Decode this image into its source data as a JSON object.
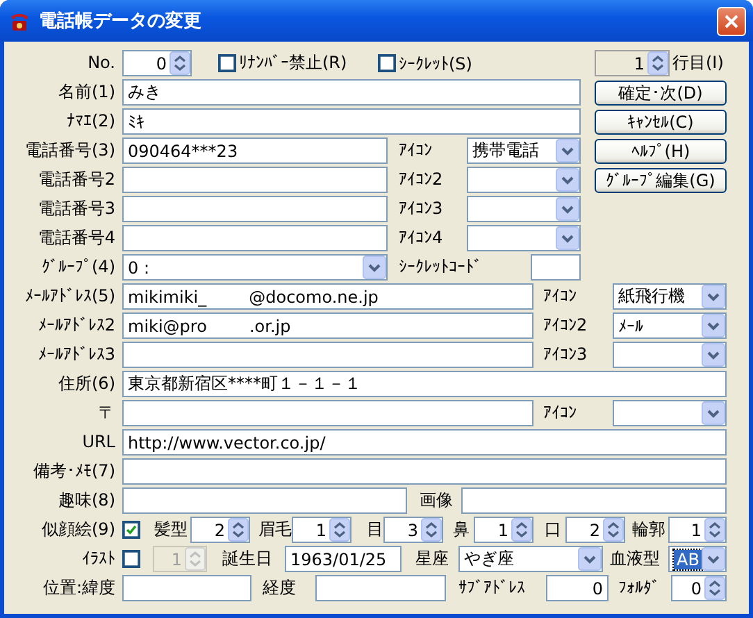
{
  "window": {
    "title": "電話帳データの変更"
  },
  "rows": [
    {
      "items": [
        {
          "kind": "label",
          "text": "No."
        },
        {
          "kind": "spin",
          "value": "0"
        },
        {
          "kind": "check",
          "label": "ﾘﾅﾝﾊﾞｰ禁止(R)",
          "checked": false
        },
        {
          "kind": "check",
          "label": "ｼｰｸﾚｯﾄ(S)",
          "checked": false
        },
        {
          "kind": "spin",
          "value": "1",
          "readonly": true
        },
        {
          "kind": "label",
          "text": "行目(I)"
        }
      ]
    },
    {
      "items": [
        {
          "kind": "label",
          "text": "名前(1)"
        },
        {
          "kind": "text",
          "value": "みき"
        },
        {
          "kind": "button",
          "text": "確定･次(D)"
        }
      ]
    },
    {
      "items": [
        {
          "kind": "label",
          "text": "ﾅﾏｴ(2)"
        },
        {
          "kind": "text",
          "value": "ﾐｷ"
        },
        {
          "kind": "button",
          "text": "ｷｬﾝｾﾙ(C)"
        }
      ]
    },
    {
      "items": [
        {
          "kind": "label",
          "text": "電話番号(3)"
        },
        {
          "kind": "text",
          "value": "090464***23"
        },
        {
          "kind": "label",
          "text": "ｱｲｺﾝ"
        },
        {
          "kind": "combo",
          "value": "携帯電話"
        },
        {
          "kind": "button",
          "text": "ﾍﾙﾌﾟ(H)"
        }
      ]
    },
    {
      "items": [
        {
          "kind": "label",
          "text": "電話番号2"
        },
        {
          "kind": "text",
          "value": ""
        },
        {
          "kind": "label",
          "text": "ｱｲｺﾝ2"
        },
        {
          "kind": "combo",
          "value": ""
        },
        {
          "kind": "button",
          "text": "ｸﾞﾙｰﾌﾟ編集(G)"
        }
      ]
    },
    {
      "items": [
        {
          "kind": "label",
          "text": "電話番号3"
        },
        {
          "kind": "text",
          "value": ""
        },
        {
          "kind": "label",
          "text": "ｱｲｺﾝ3"
        },
        {
          "kind": "combo",
          "value": ""
        }
      ]
    },
    {
      "items": [
        {
          "kind": "label",
          "text": "電話番号4"
        },
        {
          "kind": "text",
          "value": ""
        },
        {
          "kind": "label",
          "text": "ｱｲｺﾝ4"
        },
        {
          "kind": "combo",
          "value": ""
        }
      ]
    },
    {
      "items": [
        {
          "kind": "label",
          "text": "ｸﾞﾙｰﾌﾟ(4)"
        },
        {
          "kind": "combo",
          "value": "0 :"
        },
        {
          "kind": "label",
          "text": "ｼｰｸﾚｯﾄｺｰﾄﾞ"
        },
        {
          "kind": "text",
          "value": ""
        }
      ]
    },
    {
      "items": [
        {
          "kind": "label",
          "text": "ﾒｰﾙｱﾄﾞﾚｽ(5)"
        },
        {
          "kind": "text",
          "value": "mikimiki_        @docomo.ne.jp"
        },
        {
          "kind": "label",
          "text": "ｱｲｺﾝ"
        },
        {
          "kind": "combo",
          "value": "紙飛行機"
        }
      ]
    },
    {
      "items": [
        {
          "kind": "label",
          "text": "ﾒｰﾙｱﾄﾞﾚｽ2"
        },
        {
          "kind": "text",
          "value": "miki@pro        .or.jp"
        },
        {
          "kind": "label",
          "text": "ｱｲｺﾝ2"
        },
        {
          "kind": "combo",
          "value": "ﾒｰﾙ"
        }
      ]
    },
    {
      "items": [
        {
          "kind": "label",
          "text": "ﾒｰﾙｱﾄﾞﾚｽ3"
        },
        {
          "kind": "text",
          "value": ""
        },
        {
          "kind": "label",
          "text": "ｱｲｺﾝ3"
        },
        {
          "kind": "combo",
          "value": ""
        }
      ]
    },
    {
      "items": [
        {
          "kind": "label",
          "text": "住所(6)"
        },
        {
          "kind": "text",
          "value": "東京都新宿区****町１－１－１"
        }
      ]
    },
    {
      "items": [
        {
          "kind": "label",
          "text": "〒"
        },
        {
          "kind": "text",
          "value": ""
        },
        {
          "kind": "label",
          "text": "ｱｲｺﾝ"
        },
        {
          "kind": "combo",
          "value": ""
        }
      ]
    },
    {
      "items": [
        {
          "kind": "label",
          "text": "URL"
        },
        {
          "kind": "text",
          "value": "http://www.vector.co.jp/"
        }
      ]
    },
    {
      "items": [
        {
          "kind": "label",
          "text": "備考･ﾒﾓ(7)"
        },
        {
          "kind": "text",
          "value": ""
        }
      ]
    },
    {
      "items": [
        {
          "kind": "label",
          "text": "趣味(8)"
        },
        {
          "kind": "text",
          "value": ""
        },
        {
          "kind": "label",
          "text": "画像"
        },
        {
          "kind": "text",
          "value": ""
        }
      ]
    },
    {
      "items": [
        {
          "kind": "label",
          "text": "似顔絵(9)"
        },
        {
          "kind": "check",
          "checked": true
        },
        {
          "kind": "label",
          "text": "髪型"
        },
        {
          "kind": "spin",
          "value": "2"
        },
        {
          "kind": "label",
          "text": "眉毛"
        },
        {
          "kind": "spin",
          "value": "1"
        },
        {
          "kind": "label",
          "text": "目"
        },
        {
          "kind": "spin",
          "value": "3"
        },
        {
          "kind": "label",
          "text": "鼻"
        },
        {
          "kind": "spin",
          "value": "1"
        },
        {
          "kind": "label",
          "text": "口"
        },
        {
          "kind": "spin",
          "value": "2"
        },
        {
          "kind": "label",
          "text": "輪郭"
        },
        {
          "kind": "spin",
          "value": "1"
        }
      ]
    },
    {
      "items": [
        {
          "kind": "label",
          "text": "ｲﾗｽﾄ"
        },
        {
          "kind": "check",
          "checked": false
        },
        {
          "kind": "spin",
          "value": "1",
          "disabled": true
        },
        {
          "kind": "label",
          "text": "誕生日"
        },
        {
          "kind": "text",
          "value": "1963/01/25"
        },
        {
          "kind": "label",
          "text": "星座"
        },
        {
          "kind": "combo",
          "value": "やぎ座"
        },
        {
          "kind": "label",
          "text": "血液型"
        },
        {
          "kind": "combo",
          "value": "AB",
          "focused": true
        }
      ]
    },
    {
      "items": [
        {
          "kind": "label",
          "text": "位置:緯度"
        },
        {
          "kind": "text",
          "value": ""
        },
        {
          "kind": "label",
          "text": "経度"
        },
        {
          "kind": "text",
          "value": ""
        },
        {
          "kind": "label",
          "text": "ｻﾌﾞｱﾄﾞﾚｽ"
        },
        {
          "kind": "number",
          "value": "0"
        },
        {
          "kind": "label",
          "text": "ﾌｫﾙﾀﾞ"
        },
        {
          "kind": "spin",
          "value": "0"
        }
      ]
    }
  ]
}
